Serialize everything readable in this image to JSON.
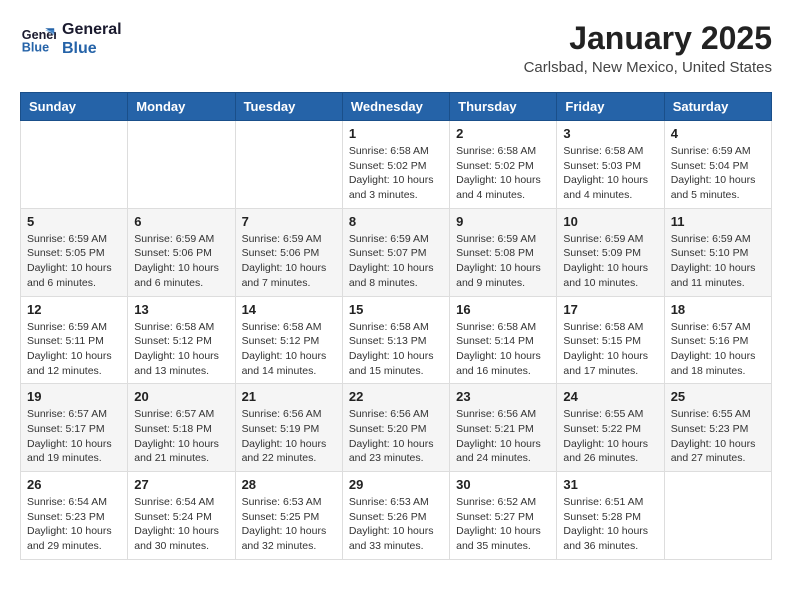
{
  "header": {
    "logo_line1": "General",
    "logo_line2": "Blue",
    "month": "January 2025",
    "location": "Carlsbad, New Mexico, United States"
  },
  "weekdays": [
    "Sunday",
    "Monday",
    "Tuesday",
    "Wednesday",
    "Thursday",
    "Friday",
    "Saturday"
  ],
  "weeks": [
    [
      {
        "day": "",
        "info": ""
      },
      {
        "day": "",
        "info": ""
      },
      {
        "day": "",
        "info": ""
      },
      {
        "day": "1",
        "info": "Sunrise: 6:58 AM\nSunset: 5:02 PM\nDaylight: 10 hours\nand 3 minutes."
      },
      {
        "day": "2",
        "info": "Sunrise: 6:58 AM\nSunset: 5:02 PM\nDaylight: 10 hours\nand 4 minutes."
      },
      {
        "day": "3",
        "info": "Sunrise: 6:58 AM\nSunset: 5:03 PM\nDaylight: 10 hours\nand 4 minutes."
      },
      {
        "day": "4",
        "info": "Sunrise: 6:59 AM\nSunset: 5:04 PM\nDaylight: 10 hours\nand 5 minutes."
      }
    ],
    [
      {
        "day": "5",
        "info": "Sunrise: 6:59 AM\nSunset: 5:05 PM\nDaylight: 10 hours\nand 6 minutes."
      },
      {
        "day": "6",
        "info": "Sunrise: 6:59 AM\nSunset: 5:06 PM\nDaylight: 10 hours\nand 6 minutes."
      },
      {
        "day": "7",
        "info": "Sunrise: 6:59 AM\nSunset: 5:06 PM\nDaylight: 10 hours\nand 7 minutes."
      },
      {
        "day": "8",
        "info": "Sunrise: 6:59 AM\nSunset: 5:07 PM\nDaylight: 10 hours\nand 8 minutes."
      },
      {
        "day": "9",
        "info": "Sunrise: 6:59 AM\nSunset: 5:08 PM\nDaylight: 10 hours\nand 9 minutes."
      },
      {
        "day": "10",
        "info": "Sunrise: 6:59 AM\nSunset: 5:09 PM\nDaylight: 10 hours\nand 10 minutes."
      },
      {
        "day": "11",
        "info": "Sunrise: 6:59 AM\nSunset: 5:10 PM\nDaylight: 10 hours\nand 11 minutes."
      }
    ],
    [
      {
        "day": "12",
        "info": "Sunrise: 6:59 AM\nSunset: 5:11 PM\nDaylight: 10 hours\nand 12 minutes."
      },
      {
        "day": "13",
        "info": "Sunrise: 6:58 AM\nSunset: 5:12 PM\nDaylight: 10 hours\nand 13 minutes."
      },
      {
        "day": "14",
        "info": "Sunrise: 6:58 AM\nSunset: 5:12 PM\nDaylight: 10 hours\nand 14 minutes."
      },
      {
        "day": "15",
        "info": "Sunrise: 6:58 AM\nSunset: 5:13 PM\nDaylight: 10 hours\nand 15 minutes."
      },
      {
        "day": "16",
        "info": "Sunrise: 6:58 AM\nSunset: 5:14 PM\nDaylight: 10 hours\nand 16 minutes."
      },
      {
        "day": "17",
        "info": "Sunrise: 6:58 AM\nSunset: 5:15 PM\nDaylight: 10 hours\nand 17 minutes."
      },
      {
        "day": "18",
        "info": "Sunrise: 6:57 AM\nSunset: 5:16 PM\nDaylight: 10 hours\nand 18 minutes."
      }
    ],
    [
      {
        "day": "19",
        "info": "Sunrise: 6:57 AM\nSunset: 5:17 PM\nDaylight: 10 hours\nand 19 minutes."
      },
      {
        "day": "20",
        "info": "Sunrise: 6:57 AM\nSunset: 5:18 PM\nDaylight: 10 hours\nand 21 minutes."
      },
      {
        "day": "21",
        "info": "Sunrise: 6:56 AM\nSunset: 5:19 PM\nDaylight: 10 hours\nand 22 minutes."
      },
      {
        "day": "22",
        "info": "Sunrise: 6:56 AM\nSunset: 5:20 PM\nDaylight: 10 hours\nand 23 minutes."
      },
      {
        "day": "23",
        "info": "Sunrise: 6:56 AM\nSunset: 5:21 PM\nDaylight: 10 hours\nand 24 minutes."
      },
      {
        "day": "24",
        "info": "Sunrise: 6:55 AM\nSunset: 5:22 PM\nDaylight: 10 hours\nand 26 minutes."
      },
      {
        "day": "25",
        "info": "Sunrise: 6:55 AM\nSunset: 5:23 PM\nDaylight: 10 hours\nand 27 minutes."
      }
    ],
    [
      {
        "day": "26",
        "info": "Sunrise: 6:54 AM\nSunset: 5:23 PM\nDaylight: 10 hours\nand 29 minutes."
      },
      {
        "day": "27",
        "info": "Sunrise: 6:54 AM\nSunset: 5:24 PM\nDaylight: 10 hours\nand 30 minutes."
      },
      {
        "day": "28",
        "info": "Sunrise: 6:53 AM\nSunset: 5:25 PM\nDaylight: 10 hours\nand 32 minutes."
      },
      {
        "day": "29",
        "info": "Sunrise: 6:53 AM\nSunset: 5:26 PM\nDaylight: 10 hours\nand 33 minutes."
      },
      {
        "day": "30",
        "info": "Sunrise: 6:52 AM\nSunset: 5:27 PM\nDaylight: 10 hours\nand 35 minutes."
      },
      {
        "day": "31",
        "info": "Sunrise: 6:51 AM\nSunset: 5:28 PM\nDaylight: 10 hours\nand 36 minutes."
      },
      {
        "day": "",
        "info": ""
      }
    ]
  ]
}
